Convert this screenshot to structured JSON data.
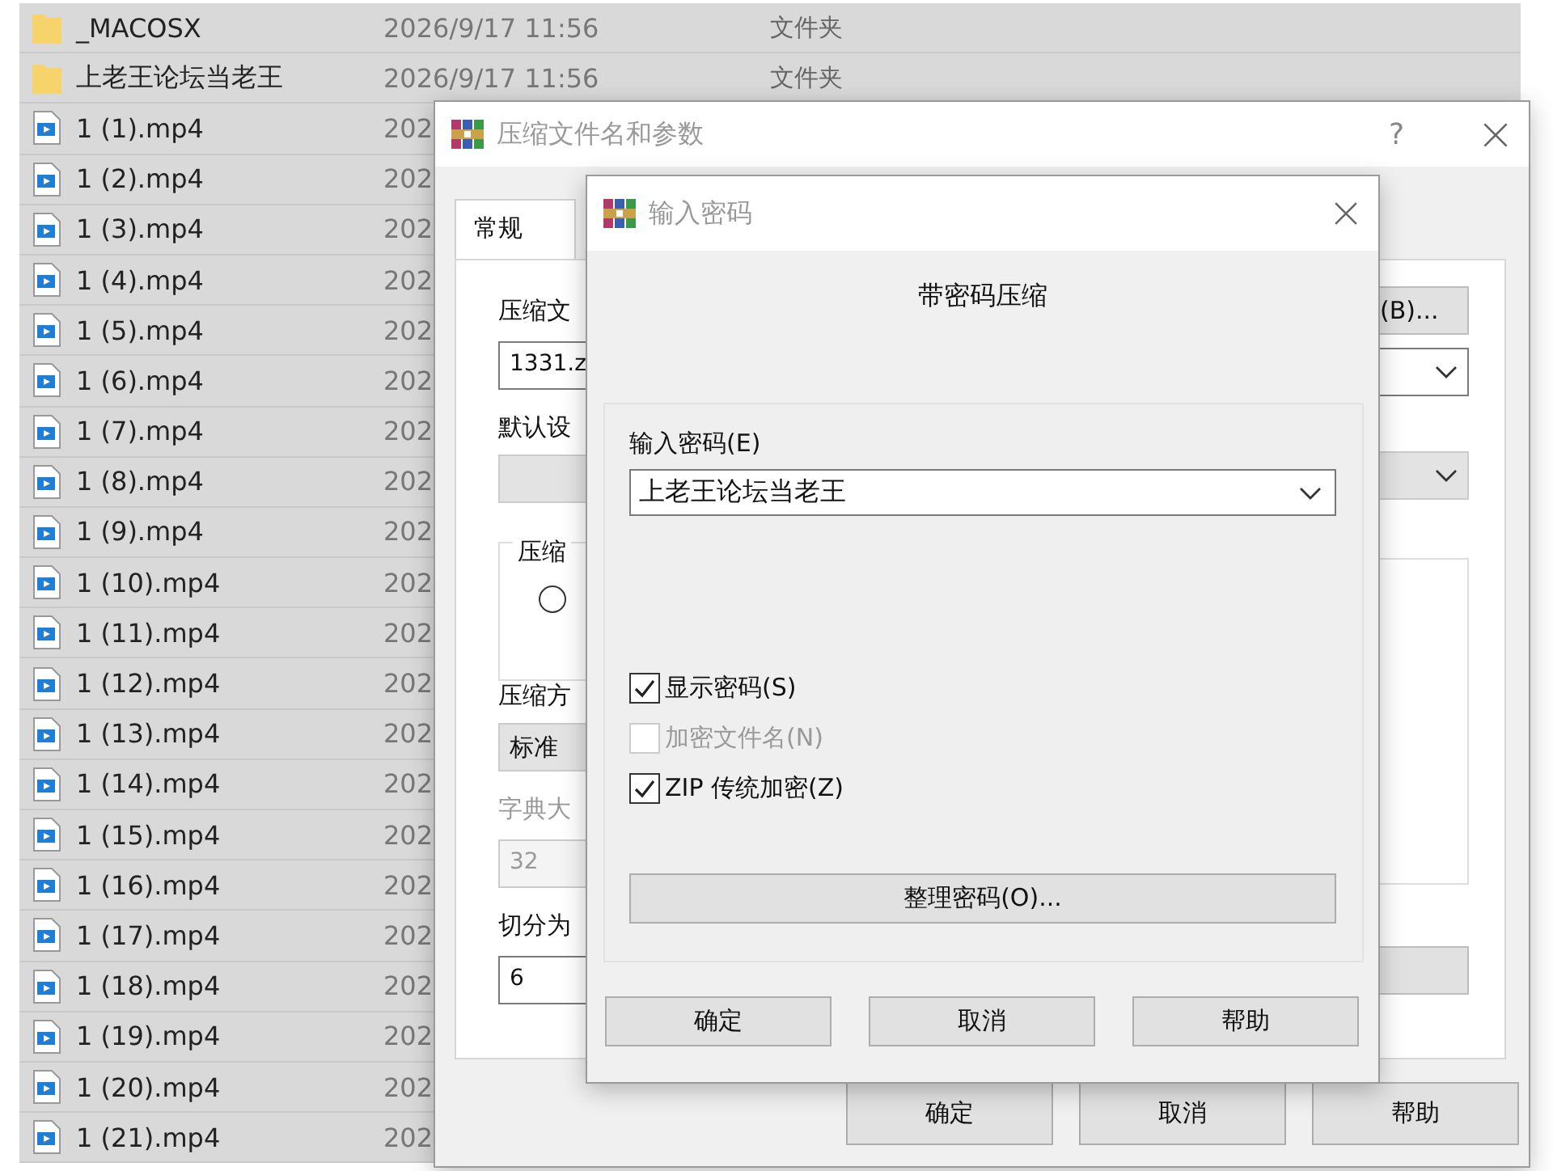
{
  "files": [
    {
      "kind": "folder",
      "name": "_MACOSX",
      "date": "2026/9/17 11:56",
      "type": "文件夹"
    },
    {
      "kind": "folder",
      "name": "上老王论坛当老王",
      "date": "2026/9/17 11:56",
      "type": "文件夹"
    },
    {
      "kind": "video",
      "name": "1 (1).mp4",
      "date": "202"
    },
    {
      "kind": "video",
      "name": "1 (2).mp4",
      "date": "202"
    },
    {
      "kind": "video",
      "name": "1 (3).mp4",
      "date": "202"
    },
    {
      "kind": "video",
      "name": "1 (4).mp4",
      "date": "202"
    },
    {
      "kind": "video",
      "name": "1 (5).mp4",
      "date": "202"
    },
    {
      "kind": "video",
      "name": "1 (6).mp4",
      "date": "202"
    },
    {
      "kind": "video",
      "name": "1 (7).mp4",
      "date": "202"
    },
    {
      "kind": "video",
      "name": "1 (8).mp4",
      "date": "202"
    },
    {
      "kind": "video",
      "name": "1 (9).mp4",
      "date": "202"
    },
    {
      "kind": "video",
      "name": "1 (10).mp4",
      "date": "202"
    },
    {
      "kind": "video",
      "name": "1 (11).mp4",
      "date": "202"
    },
    {
      "kind": "video",
      "name": "1 (12).mp4",
      "date": "202"
    },
    {
      "kind": "video",
      "name": "1 (13).mp4",
      "date": "202"
    },
    {
      "kind": "video",
      "name": "1 (14).mp4",
      "date": "202"
    },
    {
      "kind": "video",
      "name": "1 (15).mp4",
      "date": "202"
    },
    {
      "kind": "video",
      "name": "1 (16).mp4",
      "date": "202"
    },
    {
      "kind": "video",
      "name": "1 (17).mp4",
      "date": "202"
    },
    {
      "kind": "video",
      "name": "1 (18).mp4",
      "date": "202"
    },
    {
      "kind": "video",
      "name": "1 (19).mp4",
      "date": "202"
    },
    {
      "kind": "video",
      "name": "1 (20).mp4",
      "date": "202"
    },
    {
      "kind": "video",
      "name": "1 (21).mp4",
      "date": "202"
    }
  ],
  "compress_dialog": {
    "title": "压缩文件名和参数",
    "help": "?",
    "tabs": [
      {
        "label": "常规",
        "selected": true
      }
    ],
    "left_controls": [
      {
        "kind": "textbox",
        "label": "压缩文",
        "value": "1331.z",
        "disabled": false
      },
      {
        "kind": "dropdown",
        "label": "默认设"
      },
      {
        "kind": "group",
        "label": "压缩",
        "radio_selected": false
      },
      {
        "kind": "dropdown",
        "label": "压缩方",
        "value": "标准"
      },
      {
        "kind": "textbox",
        "label": "字典大",
        "value": "32",
        "disabled": true
      },
      {
        "kind": "textbox",
        "label": "切分为",
        "value": "6",
        "disabled": false
      }
    ],
    "browse_button": "(B)...",
    "buttons": [
      "确定",
      "取消",
      "帮助"
    ]
  },
  "password_dialog": {
    "title": "输入密码",
    "heading": "带密码压缩",
    "password_label": "输入密码(E)",
    "password_value": "上老王论坛当老王",
    "checkboxes": [
      {
        "label": "显示密码(S)",
        "checked": true,
        "disabled": false
      },
      {
        "label": "加密文件名(N)",
        "checked": false,
        "disabled": true
      },
      {
        "label": "ZIP 传统加密(Z)",
        "checked": true,
        "disabled": false
      }
    ],
    "organize_button": "整理密码(O)...",
    "buttons": [
      "确定",
      "取消",
      "帮助"
    ]
  }
}
